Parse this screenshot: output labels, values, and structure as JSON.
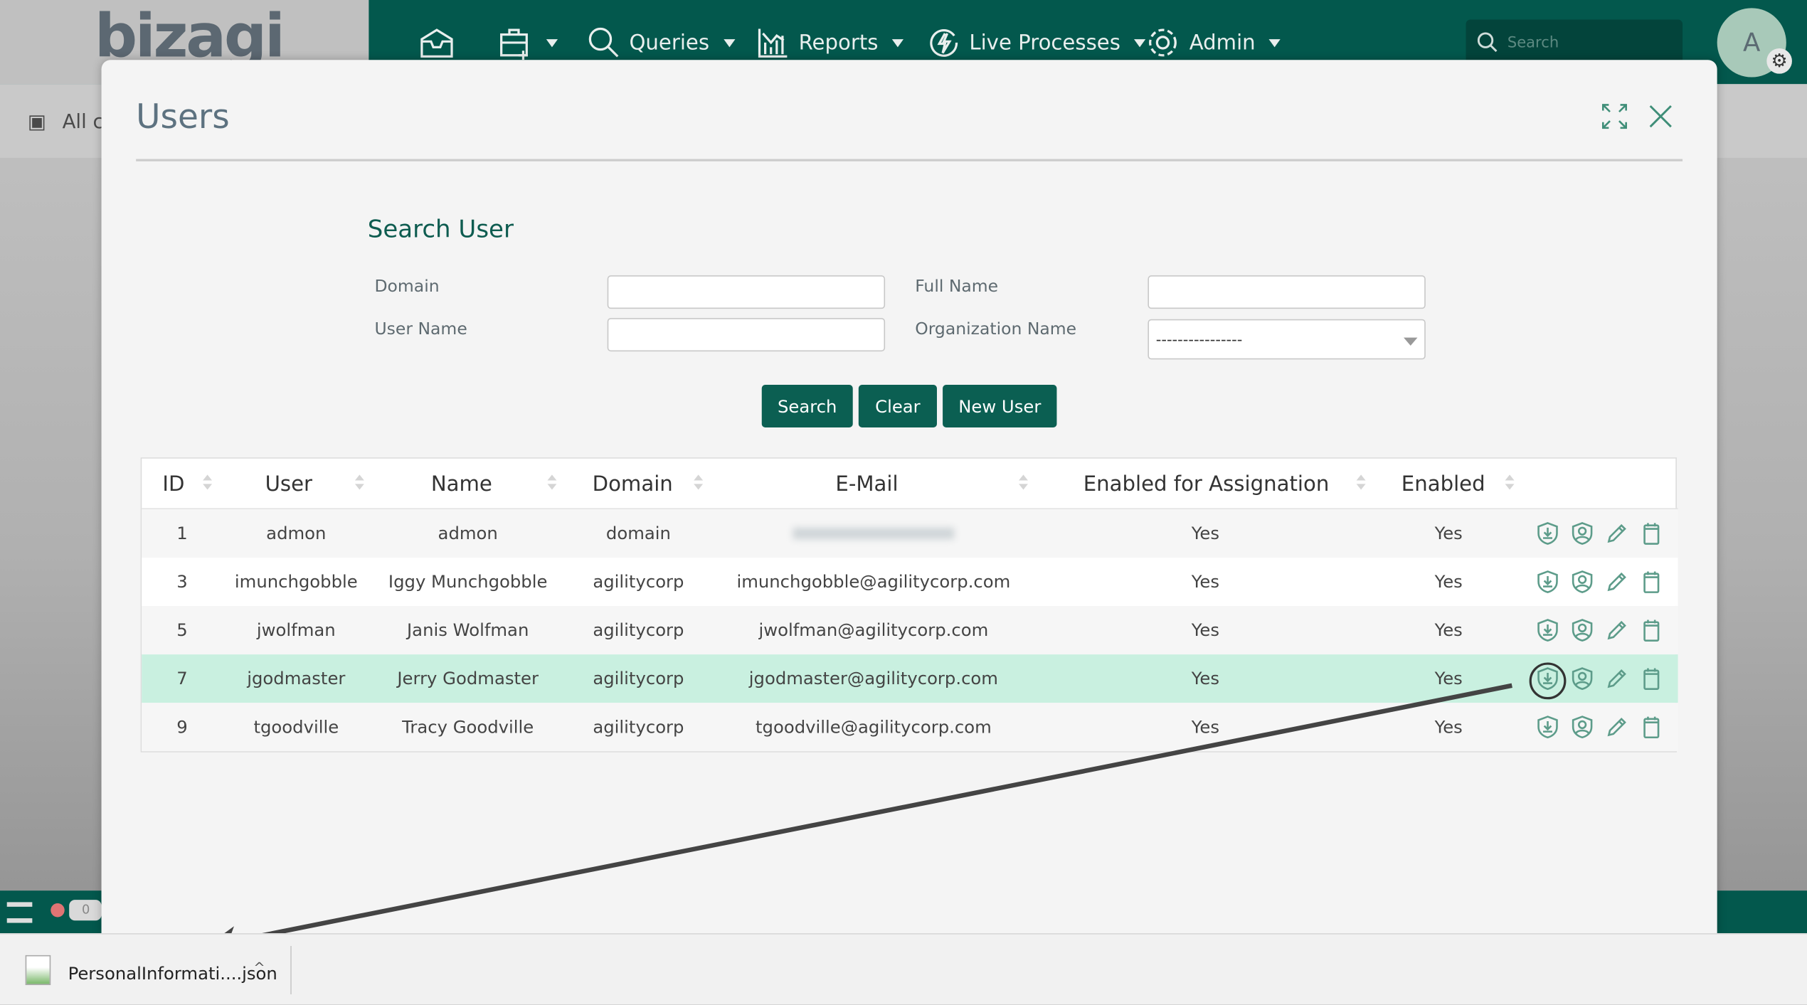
{
  "header": {
    "logo": "bizagi",
    "nav": [
      {
        "label": "",
        "icon": "inbox-icon"
      },
      {
        "label": "",
        "icon": "new-case-icon"
      },
      {
        "label": "Queries",
        "icon": "search-icon"
      },
      {
        "label": "Reports",
        "icon": "chart-icon"
      },
      {
        "label": "Live Processes",
        "icon": "lightning-icon"
      },
      {
        "label": "Admin",
        "icon": "gear-icon"
      }
    ],
    "search_placeholder": "Search",
    "avatar": "A"
  },
  "subbar": {
    "label": "All c"
  },
  "modal": {
    "title": "Users",
    "section_title": "Search User",
    "form": {
      "domain_label": "Domain",
      "domain_value": "",
      "user_name_label": "User Name",
      "user_name_value": "",
      "full_name_label": "Full Name",
      "full_name_value": "",
      "org_label": "Organization Name",
      "org_value": "----------------"
    },
    "buttons": {
      "search": "Search",
      "clear": "Clear",
      "new_user": "New User"
    },
    "table": {
      "headers": [
        "ID",
        "User",
        "Name",
        "Domain",
        "E-Mail",
        "Enabled for Assignation",
        "Enabled"
      ],
      "rows": [
        {
          "id": "1",
          "user": "admon",
          "name": "admon",
          "domain": "domain",
          "email": "",
          "assign": "Yes",
          "enabled": "Yes"
        },
        {
          "id": "3",
          "user": "imunchgobble",
          "name": "Iggy Munchgobble",
          "domain": "agilitycorp",
          "email": "imunchgobble@agilitycorp.com",
          "assign": "Yes",
          "enabled": "Yes"
        },
        {
          "id": "5",
          "user": "jwolfman",
          "name": "Janis Wolfman",
          "domain": "agilitycorp",
          "email": "jwolfman@agilitycorp.com",
          "assign": "Yes",
          "enabled": "Yes"
        },
        {
          "id": "7",
          "user": "jgodmaster",
          "name": "Jerry Godmaster",
          "domain": "agilitycorp",
          "email": "jgodmaster@agilitycorp.com",
          "assign": "Yes",
          "enabled": "Yes"
        },
        {
          "id": "9",
          "user": "tgoodville",
          "name": "Tracy Goodville",
          "domain": "agilitycorp",
          "email": "tgoodville@agilitycorp.com",
          "assign": "Yes",
          "enabled": "Yes"
        }
      ],
      "selected_row": "7"
    }
  },
  "taskbar": {
    "badge": "0"
  },
  "download": {
    "filename": "PersonalInformati....json"
  },
  "colors": {
    "brand": "#03584d",
    "button": "#0b5f52",
    "highlight_row": "#c9f0e0",
    "icon": "#5d9c8a"
  }
}
